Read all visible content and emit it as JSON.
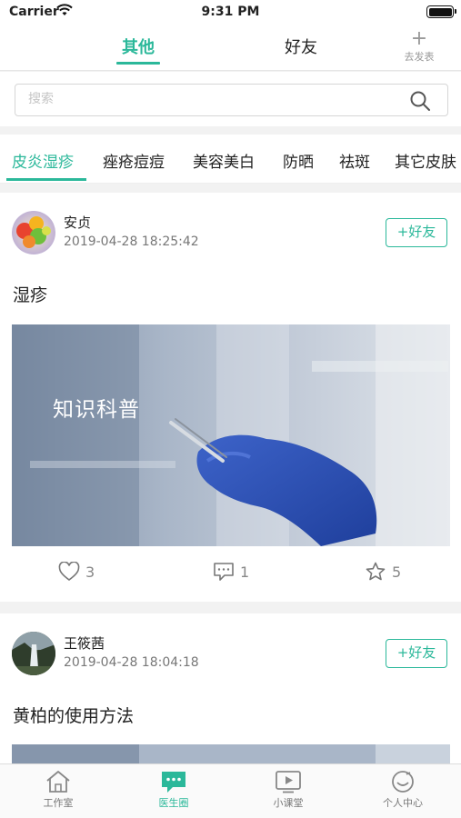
{
  "status_bar": {
    "carrier": "Carrier",
    "time": "9:31 PM"
  },
  "top_tabs": {
    "tabs": [
      "其他",
      "好友"
    ],
    "post_label": "去发表"
  },
  "search": {
    "placeholder": "搜索"
  },
  "categories": [
    "皮炎湿疹",
    "痤疮痘痘",
    "美容美白",
    "防晒",
    "祛斑",
    "其它皮肤"
  ],
  "posts": [
    {
      "user": "安贞",
      "time": "2019-04-28 18:25:42",
      "friend_label": "+好友",
      "title": "湿疹",
      "cover_text": "知识科普",
      "likes": "3",
      "comments": "1",
      "favorites": "5"
    },
    {
      "user": "王筱茜",
      "time": "2019-04-28 18:04:18",
      "friend_label": "+好友",
      "title": "黄柏的使用方法"
    }
  ],
  "tabbar": [
    "工作室",
    "医生圈",
    "小课堂",
    "个人中心"
  ],
  "colors": {
    "accent": "#2bb89a"
  }
}
